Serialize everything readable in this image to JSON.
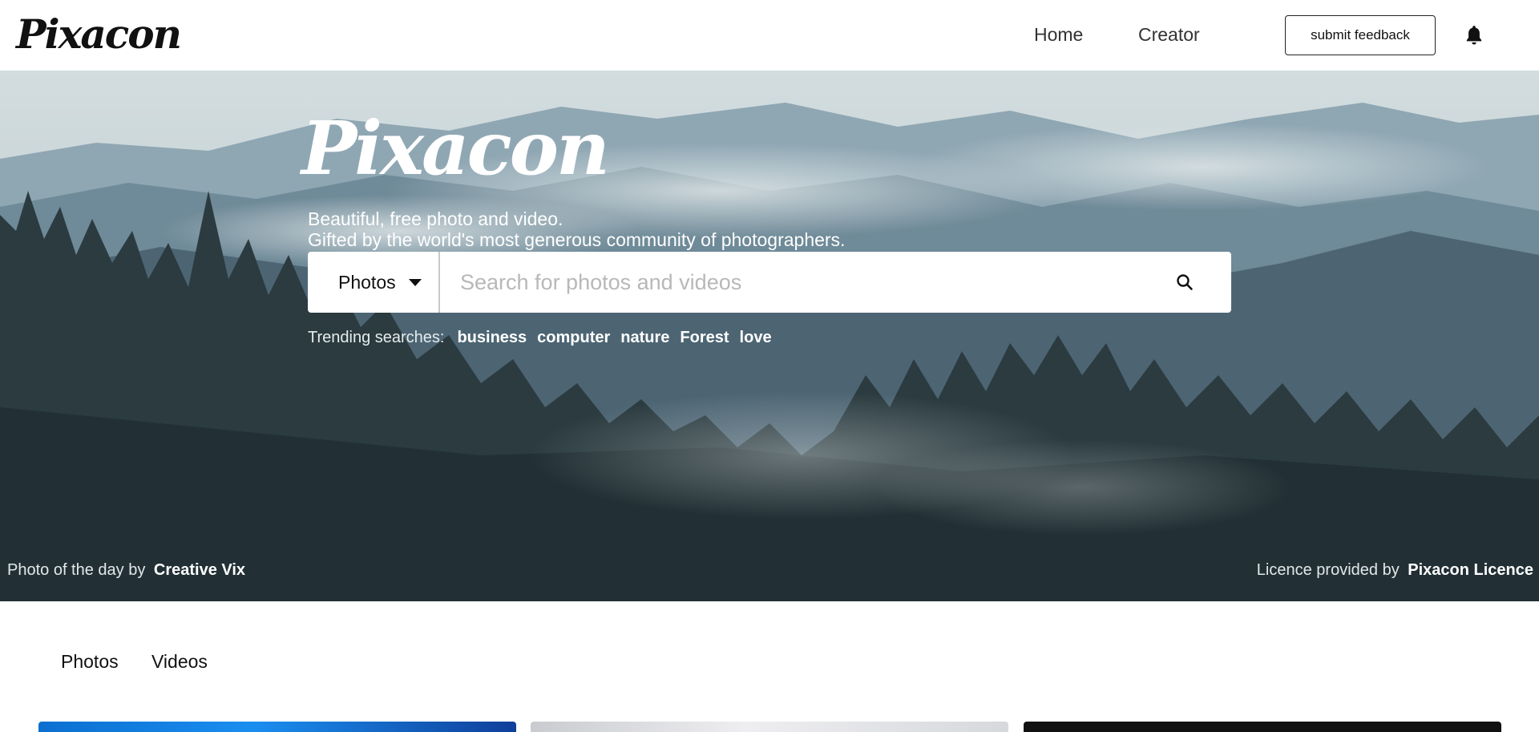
{
  "header": {
    "logo_text": "Pixacon",
    "nav": [
      {
        "label": "Home"
      },
      {
        "label": "Creator"
      }
    ],
    "feedback_label": "submit feedback",
    "notification_icon": "bell-icon"
  },
  "hero": {
    "logo_text": "Pixacon",
    "tagline_line1": "Beautiful, free photo and video.",
    "tagline_line2": "Gifted by the world's most generous community of photographers.",
    "search": {
      "type_selected": "Photos",
      "placeholder": "Search for photos and videos",
      "icon": "search-icon"
    },
    "trending_label": "Trending searches:",
    "trending_tags": [
      "business",
      "computer",
      "nature",
      "Forest",
      "love"
    ],
    "photo_credit_prefix": "Photo of the day by",
    "photo_credit_name": "Creative Vix",
    "licence_prefix": "Licence provided by",
    "licence_name": "Pixacon Licence"
  },
  "tabs": [
    {
      "label": "Photos"
    },
    {
      "label": "Videos"
    }
  ],
  "colors": {
    "brand": "#111111",
    "hero_text": "#ffffff",
    "placeholder": "#b8b8b8"
  }
}
